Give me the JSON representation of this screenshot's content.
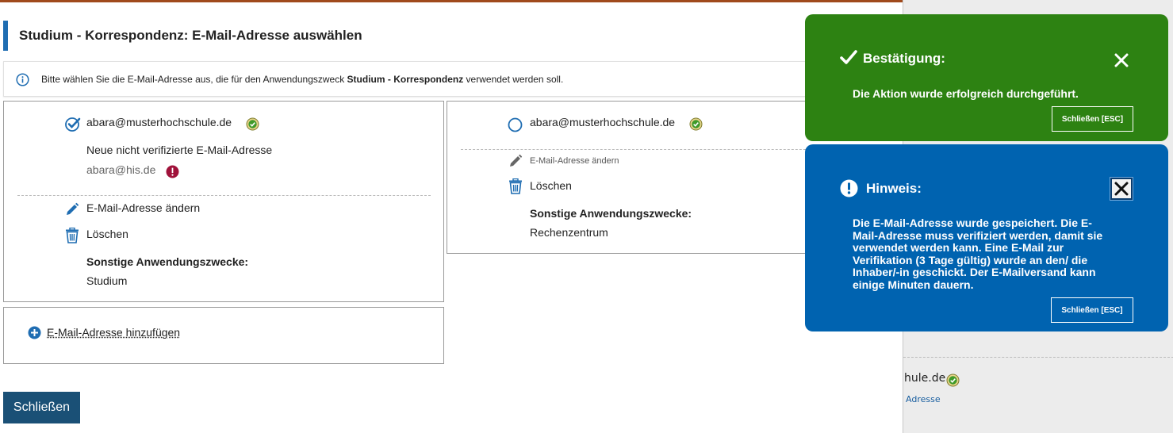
{
  "dialog": {
    "title": "Studium - Korrespondenz: E-Mail-Adresse auswählen",
    "info": {
      "prefix": "Bitte wählen Sie die E-Mail-Adresse aus, die für den Anwendungszweck ",
      "bold": "Studium - Korrespondenz",
      "suffix": " verwendet werden soll."
    },
    "cards": [
      {
        "email": "abara@musterhochschule.de",
        "selected": true,
        "unverified_label": "Neue nicht verifizierte E-Mail-Adresse",
        "unverified_email": "abara@his.de",
        "edit_label": "E-Mail-Adresse ändern",
        "delete_label": "Löschen",
        "other_purposes_label": "Sonstige Anwendungszwecke:",
        "other_purposes_value": "Studium"
      },
      {
        "email": "abara@musterhochschule.de",
        "selected": false,
        "edit_label": "E-Mail-Adresse ändern",
        "delete_label": "Löschen",
        "other_purposes_label": "Sonstige Anwendungszwecke:",
        "other_purposes_value": "Rechenzentrum"
      }
    ],
    "add_label": "E-Mail-Adresse hinzufügen",
    "close_label": "Schließen"
  },
  "background": {
    "text_fragment": "hule.de",
    "link_fragment": "Adresse"
  },
  "toasts": {
    "success": {
      "title": "Bestätigung:",
      "message": "Die Aktion wurde erfolgreich durchgeführt.",
      "button": "Schließen [ESC]"
    },
    "info": {
      "title": "Hinweis:",
      "message_lines": [
        "Die E-Mail-Adresse wurde gespeichert. Die E-",
        "Mail-Adresse muss verifiziert werden, damit sie",
        "verwendet werden kann. Eine E-Mail zur",
        "Verifikation (3 Tage gültig) wurde an den/ die",
        "Inhaber/-in geschickt. Der E-Mailversand kann",
        "einige Minuten dauern."
      ],
      "button": "Schließen [ESC]"
    }
  },
  "colors": {
    "accent": "#1f6db2",
    "success": "#2d8212",
    "info": "#0063b0",
    "error": "#a0123a",
    "button": "#1a5076"
  }
}
